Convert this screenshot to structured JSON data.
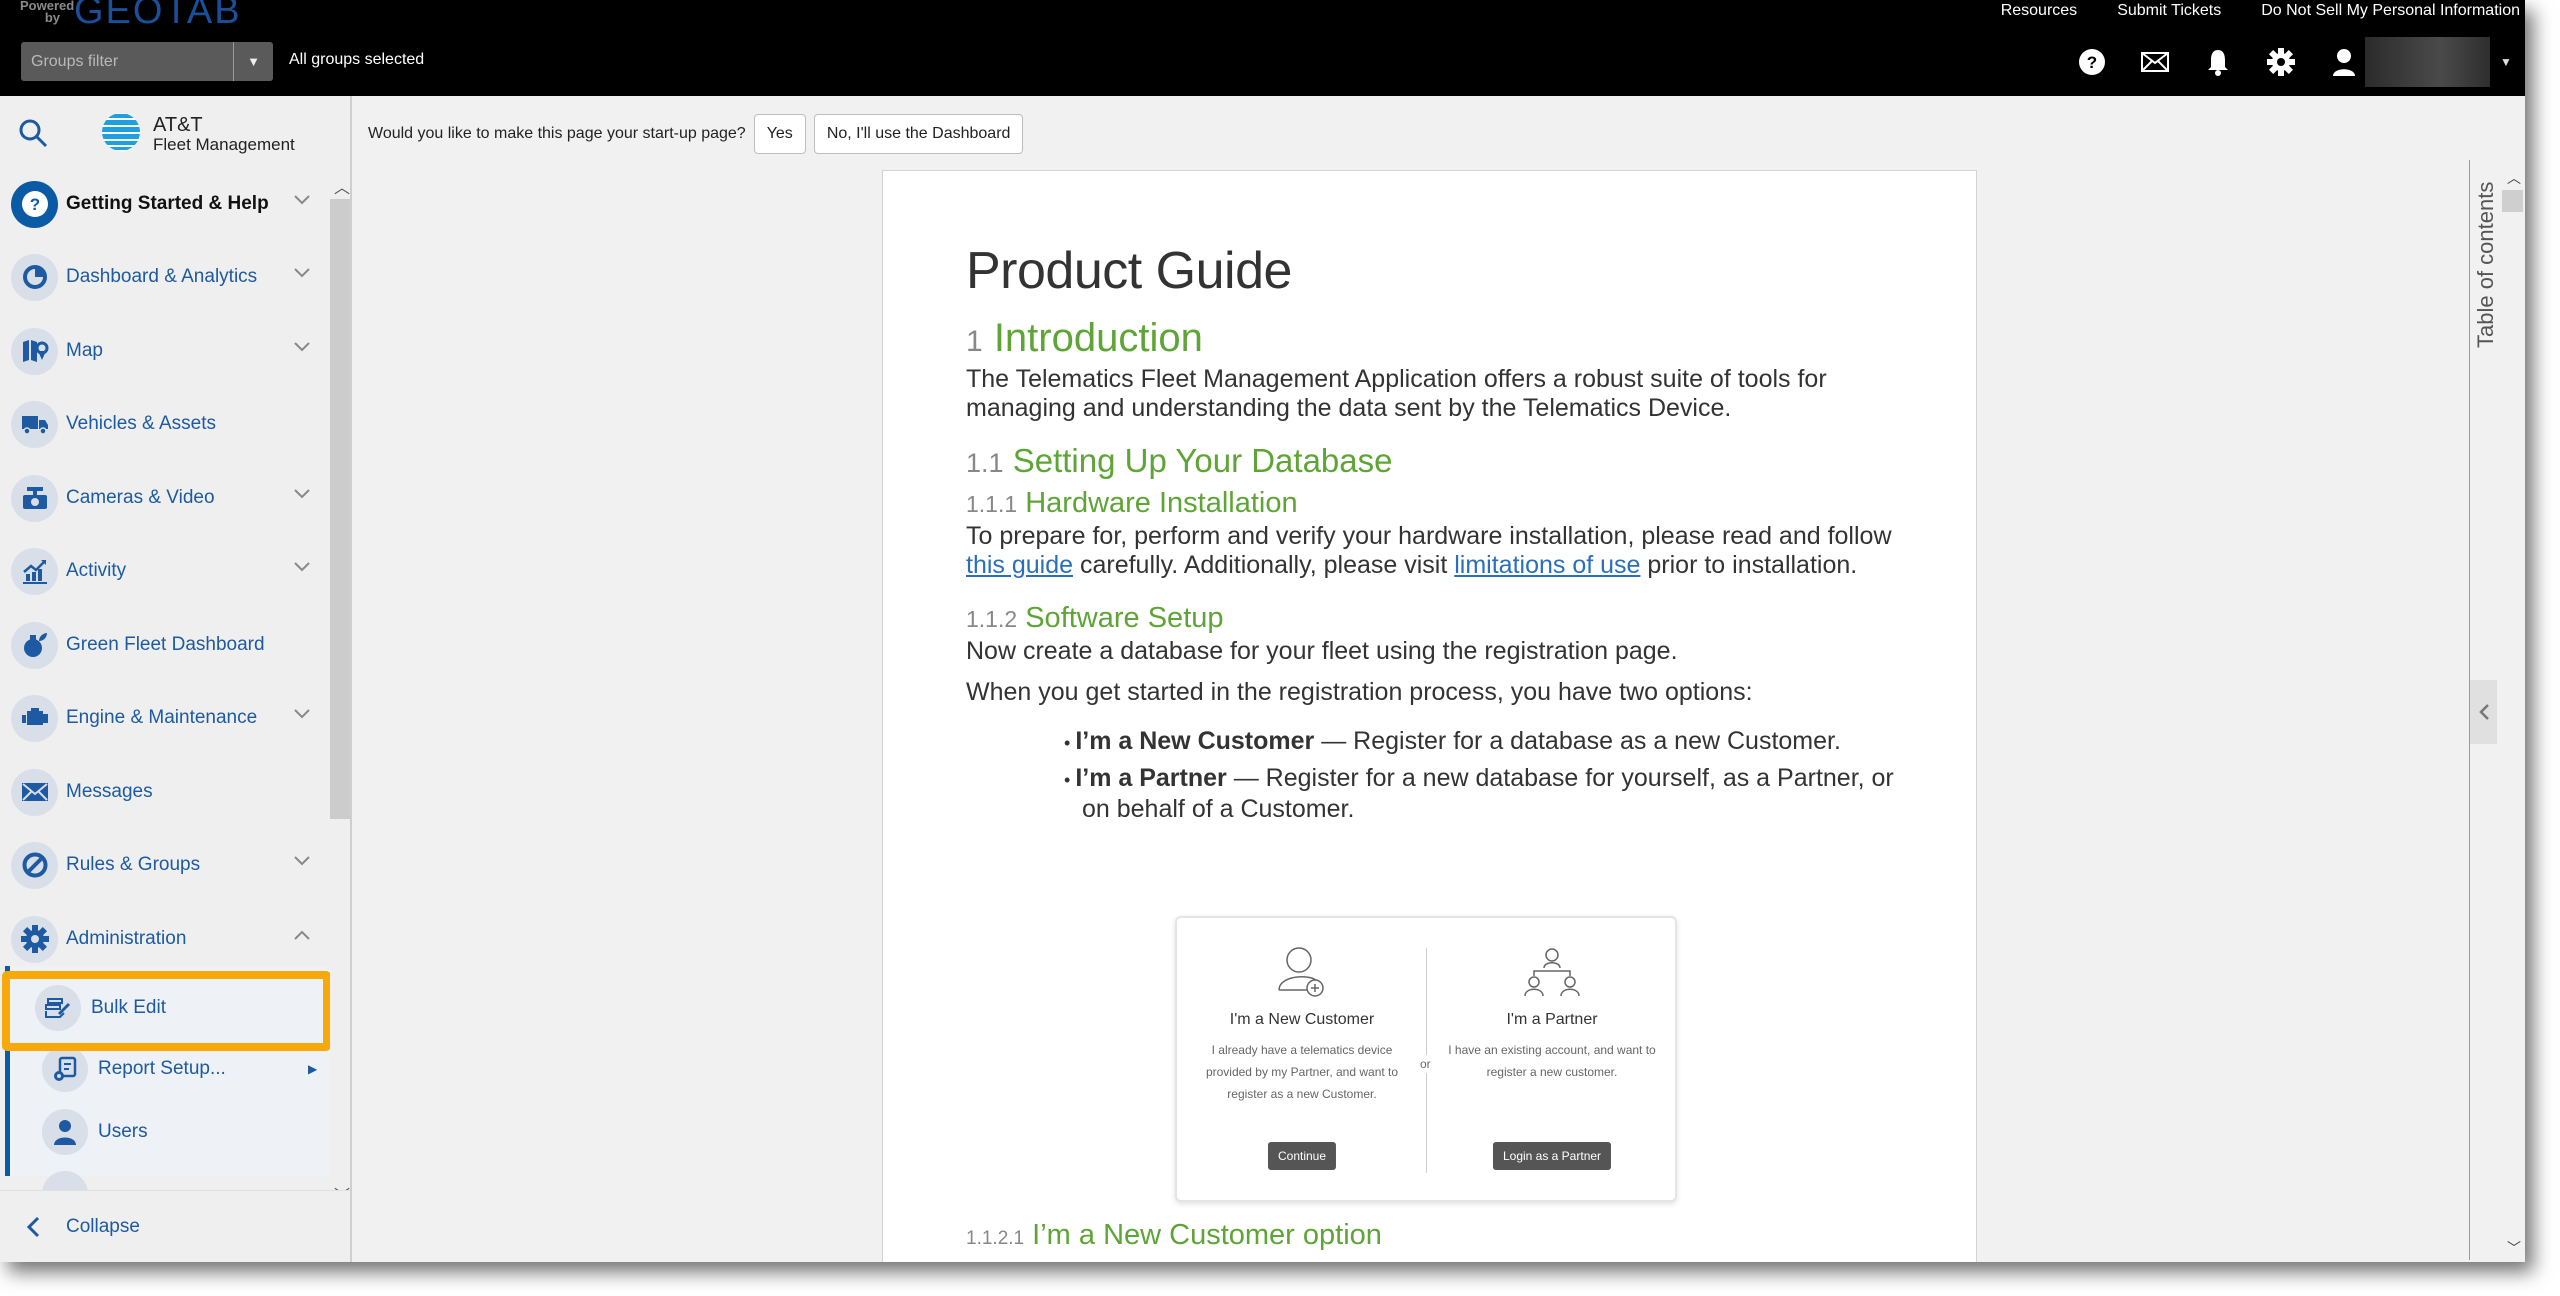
{
  "topbar": {
    "powered_by": "Powered by",
    "brand": "GEOTAB",
    "groups_filter_placeholder": "Groups filter",
    "groups_status": "All groups selected",
    "links": [
      "Resources",
      "Submit Tickets",
      "Do Not Sell My Personal Information"
    ],
    "icons": [
      "help-icon",
      "mail-icon",
      "bell-icon",
      "gear-icon",
      "user-icon"
    ]
  },
  "sidebar": {
    "logo_line1": "AT&T",
    "logo_line2": "Fleet Management",
    "items": [
      {
        "label": "Getting Started & Help",
        "icon": "help-circle-icon",
        "expandable": true,
        "active": true
      },
      {
        "label": "Dashboard & Analytics",
        "icon": "pie-chart-icon",
        "expandable": true
      },
      {
        "label": "Map",
        "icon": "map-icon",
        "expandable": true
      },
      {
        "label": "Vehicles & Assets",
        "icon": "truck-icon",
        "expandable": false
      },
      {
        "label": "Cameras & Video",
        "icon": "camera-icon",
        "expandable": true
      },
      {
        "label": "Activity",
        "icon": "activity-chart-icon",
        "expandable": true
      },
      {
        "label": "Green Fleet Dashboard",
        "icon": "leaf-icon",
        "expandable": false
      },
      {
        "label": "Engine & Maintenance",
        "icon": "engine-icon",
        "expandable": true
      },
      {
        "label": "Messages",
        "icon": "envelope-icon",
        "expandable": false
      },
      {
        "label": "Rules & Groups",
        "icon": "rules-icon",
        "expandable": true
      },
      {
        "label": "Administration",
        "icon": "gear-icon",
        "expandable": true,
        "expanded": true
      }
    ],
    "sub_items": [
      {
        "label": "Bulk Edit",
        "icon": "bulk-edit-icon",
        "highlighted": true
      },
      {
        "label": "Report Setup...",
        "icon": "report-setup-icon",
        "has_submenu": true
      },
      {
        "label": "Users",
        "icon": "user-icon"
      }
    ],
    "collapse_label": "Collapse"
  },
  "startup_prompt": {
    "question": "Would you like to make this page your start-up page?",
    "yes_label": "Yes",
    "no_label": "No, I'll use the Dashboard"
  },
  "document": {
    "title": "Product Guide",
    "sections": {
      "intro_num": "1",
      "intro_title": "Introduction",
      "intro_text": "The Telematics Fleet Management Application offers a robust suite of tools for managing and understanding the data sent by the Telematics Device.",
      "setup_num": "1.1",
      "setup_title": "Setting Up Your Database",
      "hw_num": "1.1.1",
      "hw_title": "Hardware Installation",
      "hw_text_1": "To prepare for, perform and verify your hardware installation, please read and follow ",
      "hw_link_1": "this guide",
      "hw_text_2": " carefully. Additionally, please visit ",
      "hw_link_2": "limitations of use",
      "hw_text_3": " prior to installation.",
      "sw_num": "1.1.2",
      "sw_title": "Software Setup",
      "sw_text_1": "Now create a database for your fleet using the registration page.",
      "sw_text_2": "When you get started in the registration process, you have two options:",
      "options": [
        {
          "bold": "I’m a New Customer",
          "text": " — Register for a database as a new Customer."
        },
        {
          "bold": "I’m a Partner",
          "text": " — Register for a new database for yourself, as a Partner, or on behalf of a Customer."
        }
      ],
      "sub_num": "1.1.2.1",
      "sub_title": "I’m a New Customer option"
    },
    "figure": {
      "left_title": "I'm a New Customer",
      "left_desc": "I already have a telematics device provided by my Partner, and want to register as a new Customer.",
      "left_button": "Continue",
      "or": "or",
      "right_title": "I'm a Partner",
      "right_desc": "I have an existing account, and want to register a new customer.",
      "right_button": "Login as a Partner"
    }
  },
  "toc": {
    "label": "Table of contents"
  }
}
